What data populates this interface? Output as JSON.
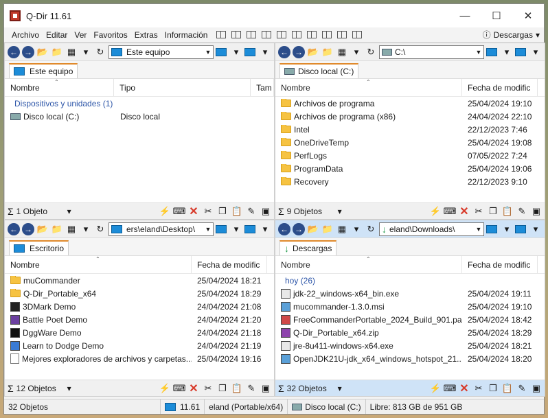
{
  "window": {
    "title": "Q-Dir 11.61"
  },
  "menu": [
    "Archivo",
    "Editar",
    "Ver",
    "Favoritos",
    "Extras",
    "Información"
  ],
  "menu_right": {
    "label": "Descargas"
  },
  "panes": [
    {
      "address": "Este equipo",
      "tab": "Este equipo",
      "columns": [
        "Nombre",
        "Tipo",
        "Tam"
      ],
      "group": "Dispositivos y unidades (1)",
      "rows": [
        [
          "Disco local (C:)",
          "Disco local",
          ""
        ]
      ],
      "status": "1 Objeto"
    },
    {
      "address": "C:\\",
      "tab": "Disco local (C:)",
      "columns": [
        "Nombre",
        "Fecha de modific"
      ],
      "group": "",
      "rows": [
        [
          "Archivos de programa",
          "25/04/2024 19:10"
        ],
        [
          "Archivos de programa (x86)",
          "24/04/2024 22:10"
        ],
        [
          "Intel",
          "22/12/2023 7:46"
        ],
        [
          "OneDriveTemp",
          "25/04/2024 19:08"
        ],
        [
          "PerfLogs",
          "07/05/2022 7:24"
        ],
        [
          "ProgramData",
          "25/04/2024 19:06"
        ],
        [
          "Recovery",
          "22/12/2023 9:10"
        ]
      ],
      "status": "9 Objetos"
    },
    {
      "address": "ers\\eland\\Desktop\\",
      "tab": "Escritorio",
      "columns": [
        "Nombre",
        "Fecha de modific"
      ],
      "group": "",
      "rows": [
        [
          "muCommander",
          "25/04/2024 18:21"
        ],
        [
          "Q-Dir_Portable_x64",
          "25/04/2024 18:29"
        ],
        [
          "3DMark Demo",
          "24/04/2024 21:08"
        ],
        [
          "Battle Poet Demo",
          "24/04/2024 21:20"
        ],
        [
          "DggWare Demo",
          "24/04/2024 21:18"
        ],
        [
          "Learn to Dodge Demo",
          "24/04/2024 21:19"
        ],
        [
          "Mejores exploradores de archivos y carpetas...",
          "25/04/2024 19:16"
        ]
      ],
      "status": "12 Objetos"
    },
    {
      "address": "eland\\Downloads\\",
      "tab": "Descargas",
      "columns": [
        "Nombre",
        "Fecha de modific"
      ],
      "group": "hoy (26)",
      "rows": [
        [
          "jdk-22_windows-x64_bin.exe",
          "25/04/2024 19:11"
        ],
        [
          "mucommander-1.3.0.msi",
          "25/04/2024 19:10"
        ],
        [
          "FreeCommanderPortable_2024_Build_901.pa...",
          "25/04/2024 18:42"
        ],
        [
          "Q-Dir_Portable_x64.zip",
          "25/04/2024 18:29"
        ],
        [
          "jre-8u411-windows-x64.exe",
          "25/04/2024 18:21"
        ],
        [
          "OpenJDK21U-jdk_x64_windows_hotspot_21....",
          "25/04/2024 18:20"
        ]
      ],
      "status": "32 Objetos"
    }
  ],
  "bottom": {
    "objects": "32 Objetos",
    "version": "11.61",
    "user": "eland (Portable/x64)",
    "drive": "Disco local (C:)",
    "free": "Libre: 813 GB de 951 GB"
  }
}
